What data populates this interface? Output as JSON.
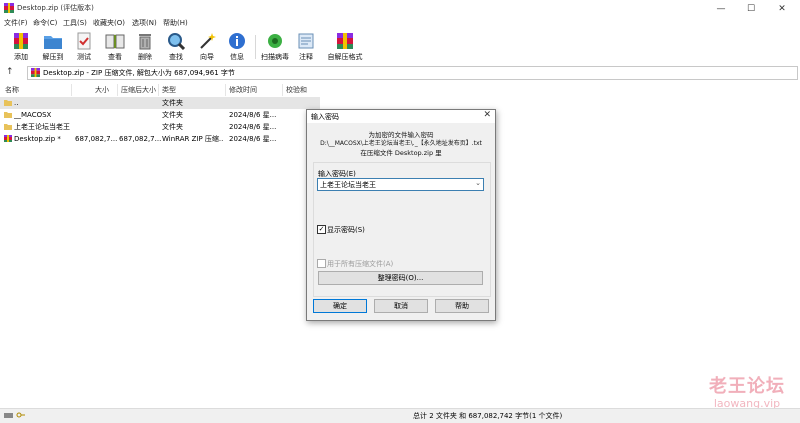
{
  "window": {
    "title": "Desktop.zip (评估版本)",
    "minimize": "—",
    "maximize": "☐",
    "close": "✕"
  },
  "menu": [
    "文件(F)",
    "命令(C)",
    "工具(S)",
    "收藏夹(O)",
    "选项(N)",
    "帮助(H)"
  ],
  "toolbar": [
    {
      "label": "添加",
      "icon": "add-archive-icon"
    },
    {
      "label": "解压到",
      "icon": "extract-to-icon"
    },
    {
      "label": "测试",
      "icon": "test-icon"
    },
    {
      "label": "查看",
      "icon": "view-icon"
    },
    {
      "label": "删除",
      "icon": "delete-icon"
    },
    {
      "label": "查找",
      "icon": "find-icon"
    },
    {
      "label": "向导",
      "icon": "wizard-icon"
    },
    {
      "label": "信息",
      "icon": "info-icon"
    },
    {
      "label": "扫描病毒",
      "icon": "virus-scan-icon"
    },
    {
      "label": "注释",
      "icon": "comment-icon"
    },
    {
      "label": "自解压格式",
      "icon": "sfx-icon"
    }
  ],
  "address": {
    "up": "↑",
    "text": "Desktop.zip - ZIP 压缩文件, 解包大小为 687,094,961 字节"
  },
  "columns": [
    "名称",
    "大小",
    "压缩后大小",
    "类型",
    "修改时间",
    "校验和"
  ],
  "files": [
    {
      "name": "..",
      "size": "",
      "packed": "",
      "type": "文件夹",
      "modified": "",
      "crc": ""
    },
    {
      "name": "__MACOSX",
      "size": "",
      "packed": "",
      "type": "文件夹",
      "modified": "2024/8/6 星...",
      "crc": ""
    },
    {
      "name": "上老王论坛当老王",
      "size": "",
      "packed": "",
      "type": "文件夹",
      "modified": "2024/8/6 星...",
      "crc": ""
    },
    {
      "name": "Desktop.zip *",
      "size": "687,082,7...",
      "packed": "687,082,7...",
      "type": "WinRAR ZIP 压缩...",
      "modified": "2024/8/6 星...",
      "crc": ""
    }
  ],
  "status": {
    "text": "总计 2 文件夹 和 687,082,742 字节(1 个文件)"
  },
  "watermark": {
    "line1": "老王论坛",
    "line2": "laowang.vip"
  },
  "dialog": {
    "title": "输入密码",
    "close": "✕",
    "message_line1": "为加密的文件输入密码",
    "message_line2": "D:\\__MACOSX\\上老王论坛当老王\\._【永久地址发布页】.txt",
    "message_line3": "在压缩文件 Desktop.zip 里",
    "password_label": "输入密码(E)",
    "password_value": "上老王论坛当老王",
    "dropdown_arrow": "⌄",
    "show_password_label": "显示密码(S)",
    "show_password_checked": "✓",
    "use_for_all_label": "用于所有压缩文件(A)",
    "organize_button": "整理密码(O)...",
    "ok_button": "确定",
    "cancel_button": "取消",
    "help_button": "帮助"
  }
}
